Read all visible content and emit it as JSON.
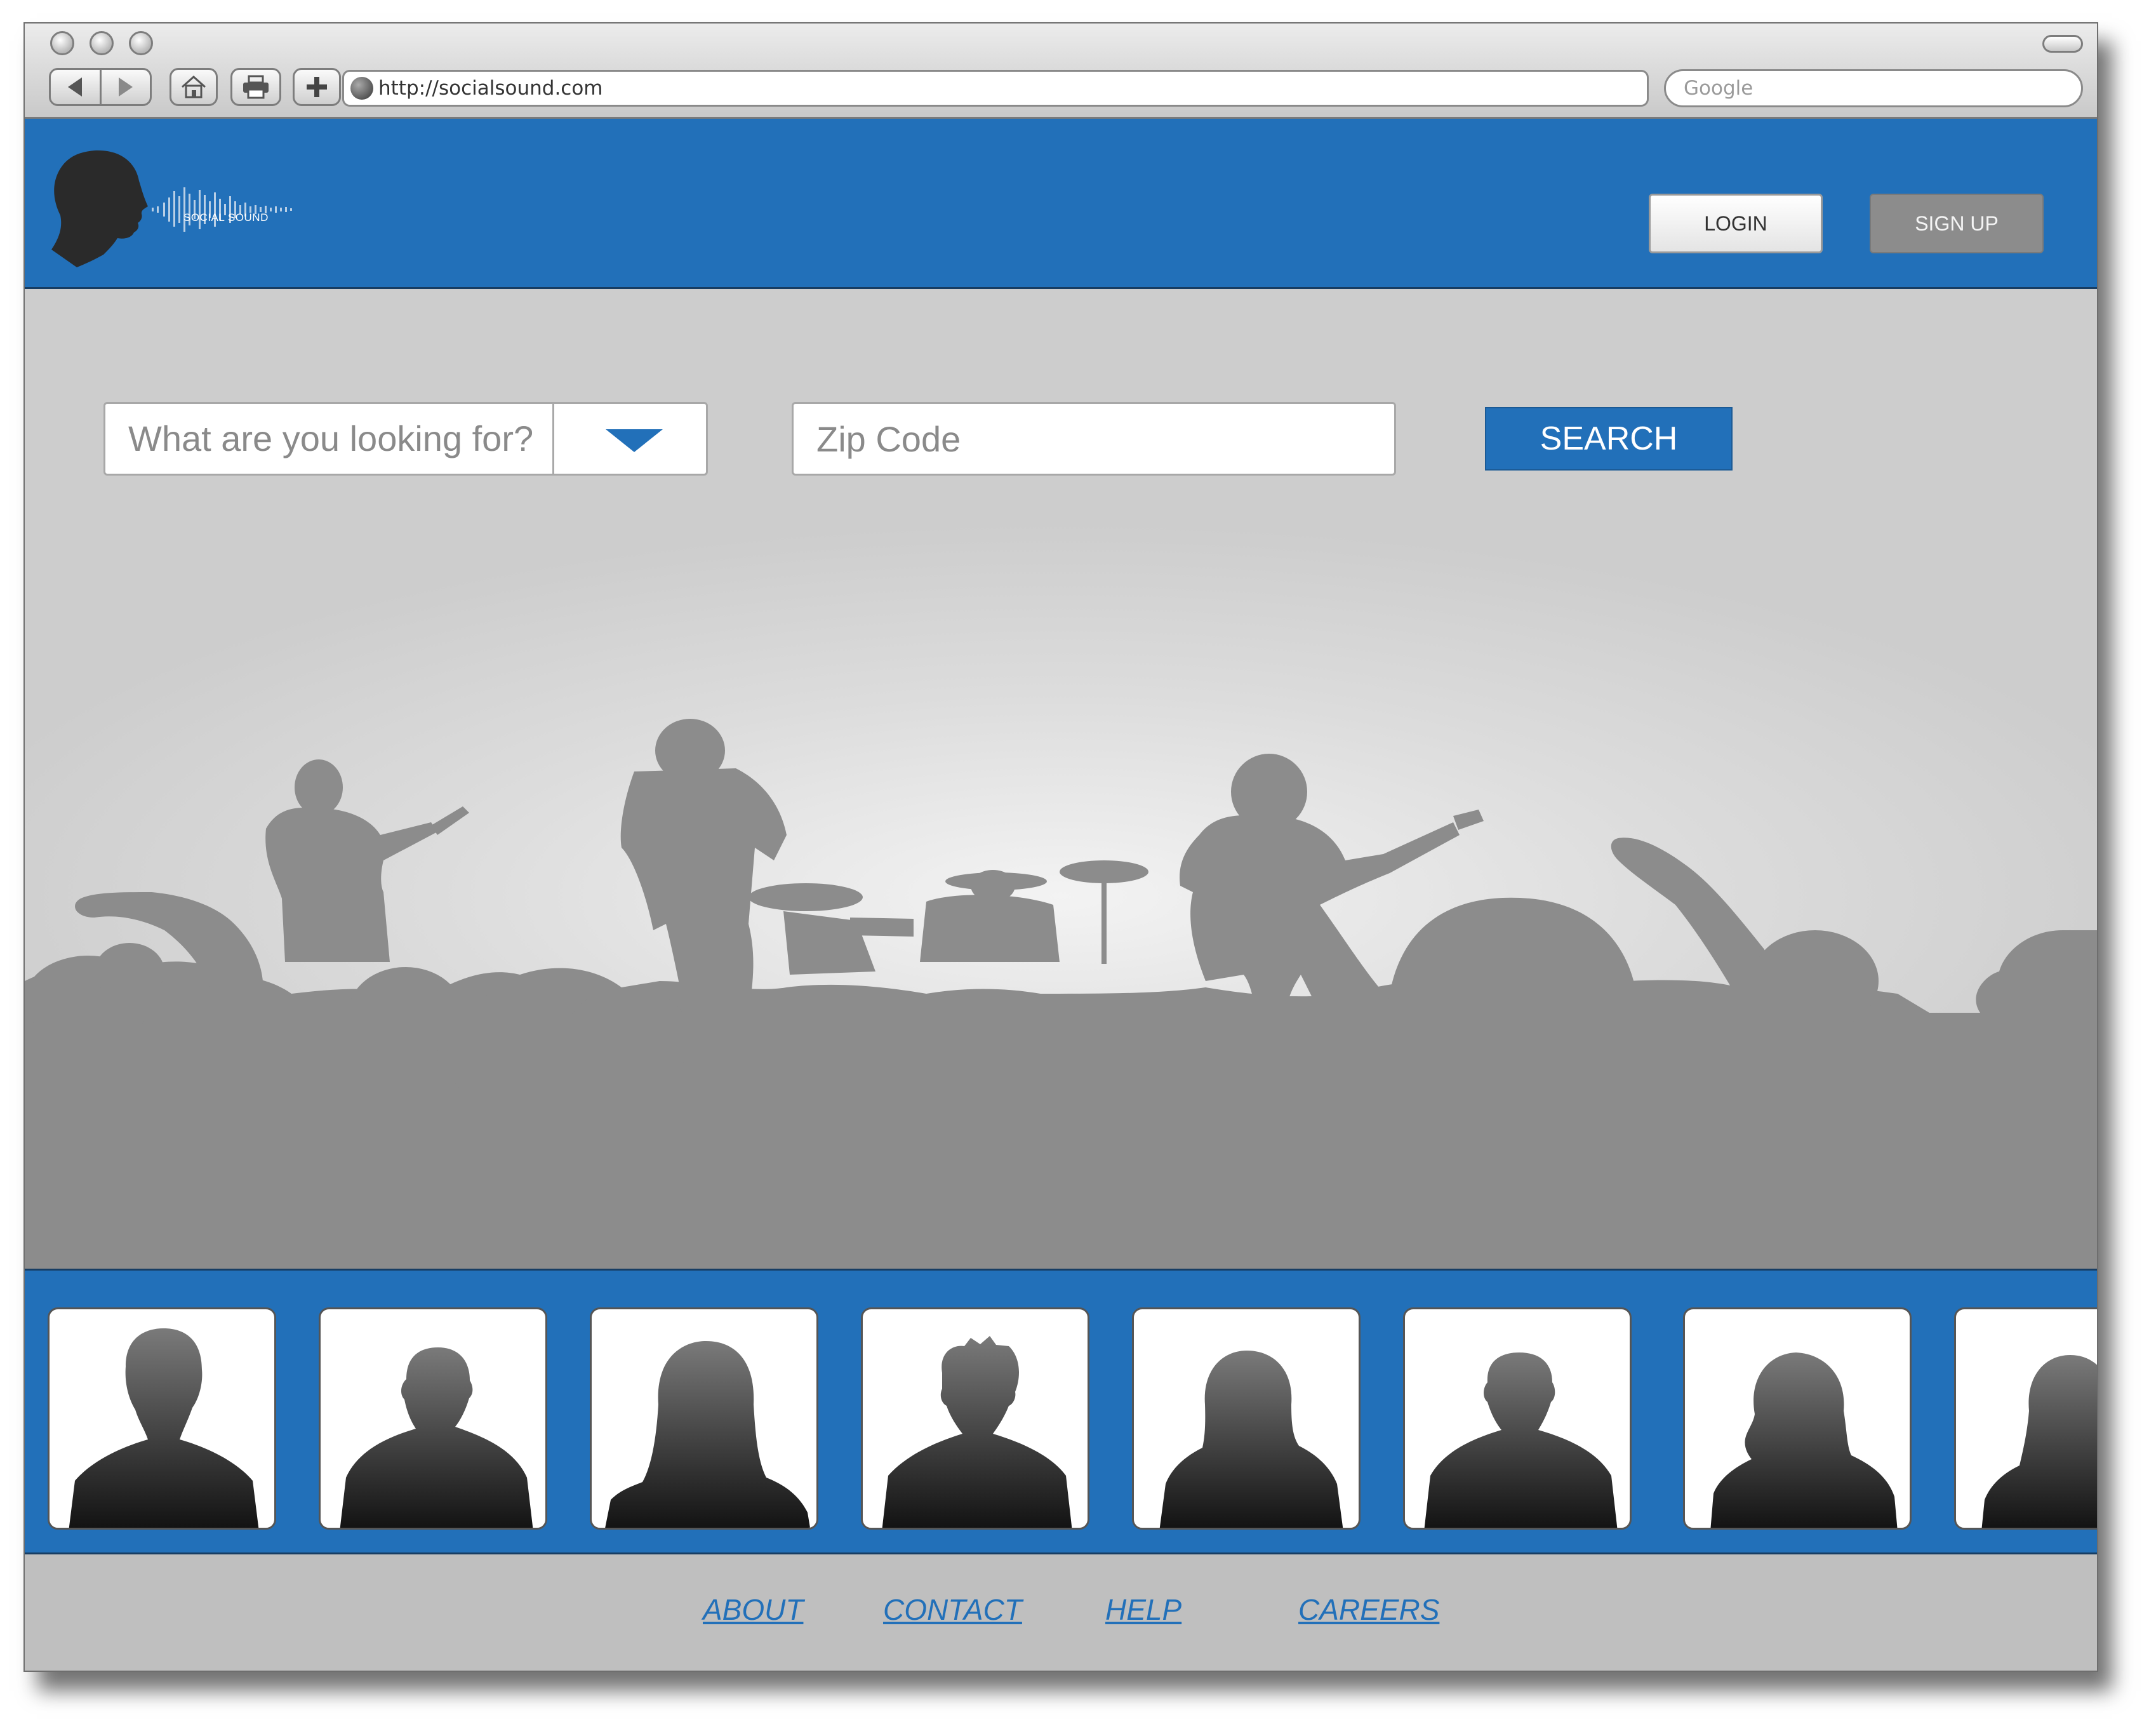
{
  "browser": {
    "url": "http://socialsound.com",
    "search_placeholder": "Google"
  },
  "header": {
    "logo_text": "SOCIAL SOUND",
    "login_label": "LOGIN",
    "signup_label": "SIGN UP"
  },
  "search": {
    "category_placeholder": "What are you looking for?",
    "zip_placeholder": "Zip Code",
    "search_label": "SEARCH"
  },
  "members": [
    {
      "icon": "person-silhouette-icon"
    },
    {
      "icon": "person-silhouette-icon"
    },
    {
      "icon": "person-silhouette-icon"
    },
    {
      "icon": "person-silhouette-icon"
    },
    {
      "icon": "person-silhouette-icon"
    },
    {
      "icon": "person-silhouette-icon"
    },
    {
      "icon": "person-silhouette-icon"
    },
    {
      "icon": "person-silhouette-icon"
    }
  ],
  "footer": {
    "links": [
      "ABOUT",
      "CONTACT",
      "HELP",
      "CAREERS"
    ]
  },
  "colors": {
    "brand_blue": "#2270b9",
    "silhouette_gray": "#8c8c8c",
    "signup_gray": "#8c8c8c"
  }
}
